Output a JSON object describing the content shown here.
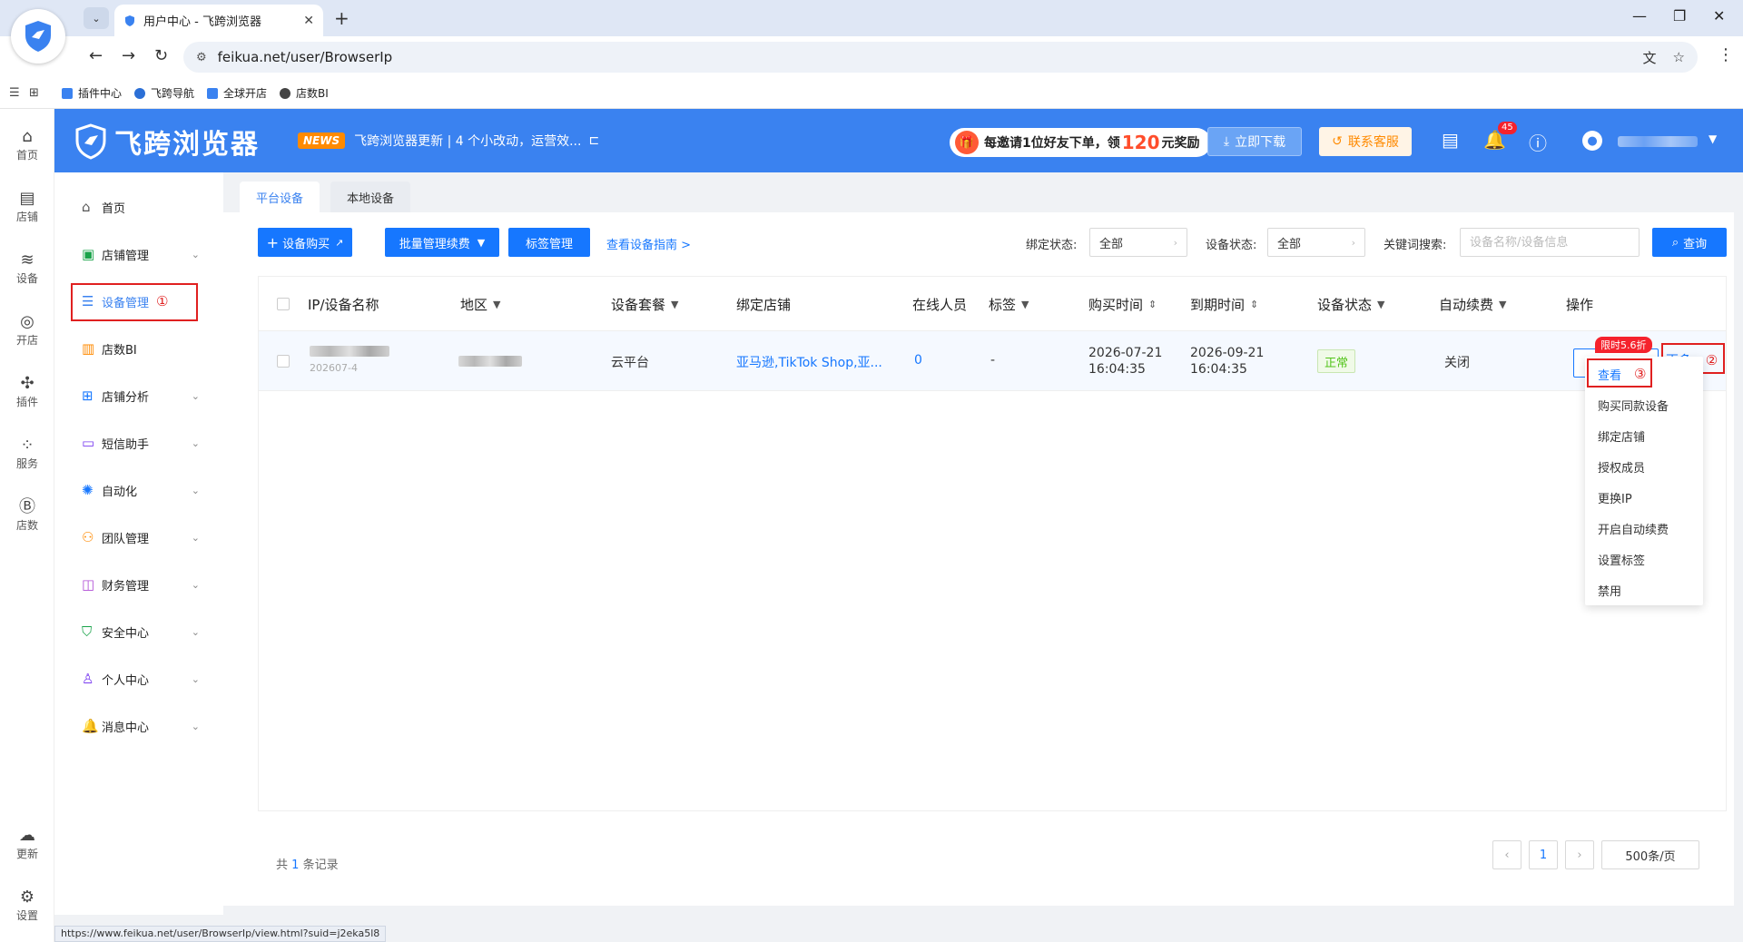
{
  "browser": {
    "tab_title": "用户中心 - 飞跨浏览器",
    "url": "feikua.net/user/BrowserIp",
    "bookmarks": [
      "插件中心",
      "飞跨导航",
      "全球开店",
      "店数BI"
    ],
    "status_url": "https://www.feikua.net/user/BrowserIp/view.html?suid=j2eka5l8"
  },
  "rail": {
    "items": [
      "首页",
      "店铺",
      "设备",
      "开店",
      "插件",
      "服务",
      "店数"
    ],
    "bottom": [
      "更新",
      "设置"
    ]
  },
  "header": {
    "brand": "飞跨浏览器",
    "news_badge": "NEWS",
    "news_text": "飞跨浏览器更新 | 4 个小改动，运营效...",
    "invite_prefix": "每邀请1位好友下单，领",
    "invite_amount": "120",
    "invite_suffix": "元奖励",
    "download_label": "立即下载",
    "service_label": "联系客服",
    "notification_count": "45"
  },
  "sidebar": {
    "items": [
      {
        "label": "首页",
        "icon": "home-icon"
      },
      {
        "label": "店铺管理",
        "icon": "shop-icon"
      },
      {
        "label": "设备管理",
        "icon": "device-icon"
      },
      {
        "label": "店数BI",
        "icon": "bar-chart-icon"
      },
      {
        "label": "店铺分析",
        "icon": "grid-icon"
      },
      {
        "label": "短信助手",
        "icon": "message-icon"
      },
      {
        "label": "自动化",
        "icon": "automation-icon"
      },
      {
        "label": "团队管理",
        "icon": "team-icon"
      },
      {
        "label": "财务管理",
        "icon": "wallet-icon"
      },
      {
        "label": "安全中心",
        "icon": "shield-check-icon"
      },
      {
        "label": "个人中心",
        "icon": "user-icon"
      },
      {
        "label": "消息中心",
        "icon": "bell-icon"
      }
    ],
    "marker_1": "①"
  },
  "tabs": [
    "平台设备",
    "本地设备"
  ],
  "toolbar": {
    "buy_label": "设备购买",
    "batch_label": "批量管理续费",
    "tag_label": "标签管理",
    "guide_link": "查看设备指南 >",
    "bind_status_label": "绑定状态:",
    "bind_status_value": "全部",
    "device_status_label": "设备状态:",
    "device_status_value": "全部",
    "keyword_label": "关键词搜索:",
    "keyword_placeholder": "设备名称/设备信息",
    "search_label": "查询"
  },
  "table": {
    "columns": [
      "IP/设备名称",
      "地区",
      "设备套餐",
      "绑定店铺",
      "在线人员",
      "标签",
      "购买时间",
      "到期时间",
      "设备状态",
      "自动续费",
      "操作"
    ],
    "row": {
      "name_sub": "202607-4",
      "plan": "云平台",
      "shops": "亚马逊,TikTok Shop,亚...",
      "online": "0",
      "tag": "-",
      "purchase_date": "2026-07-21",
      "purchase_time": "16:04:35",
      "expire_date": "2026-09-21",
      "expire_time": "16:04:35",
      "status": "正常",
      "auto_renew": "关闭",
      "renew_label": "续费设备",
      "discount": "限时5.6折",
      "more_label": "更多",
      "marker_2": "②"
    }
  },
  "dropdown": {
    "items": [
      "查看",
      "购买同款设备",
      "绑定店铺",
      "授权成员",
      "更换IP",
      "开启自动续费",
      "设置标签",
      "禁用"
    ],
    "marker_3": "③"
  },
  "pagination": {
    "total_prefix": "共",
    "total_count": "1",
    "total_suffix": "条记录",
    "current_page": "1",
    "page_size": "500条/页"
  },
  "colors": {
    "primary": "#3a82f0",
    "link": "#1677ff",
    "highlight": "#e02020"
  }
}
